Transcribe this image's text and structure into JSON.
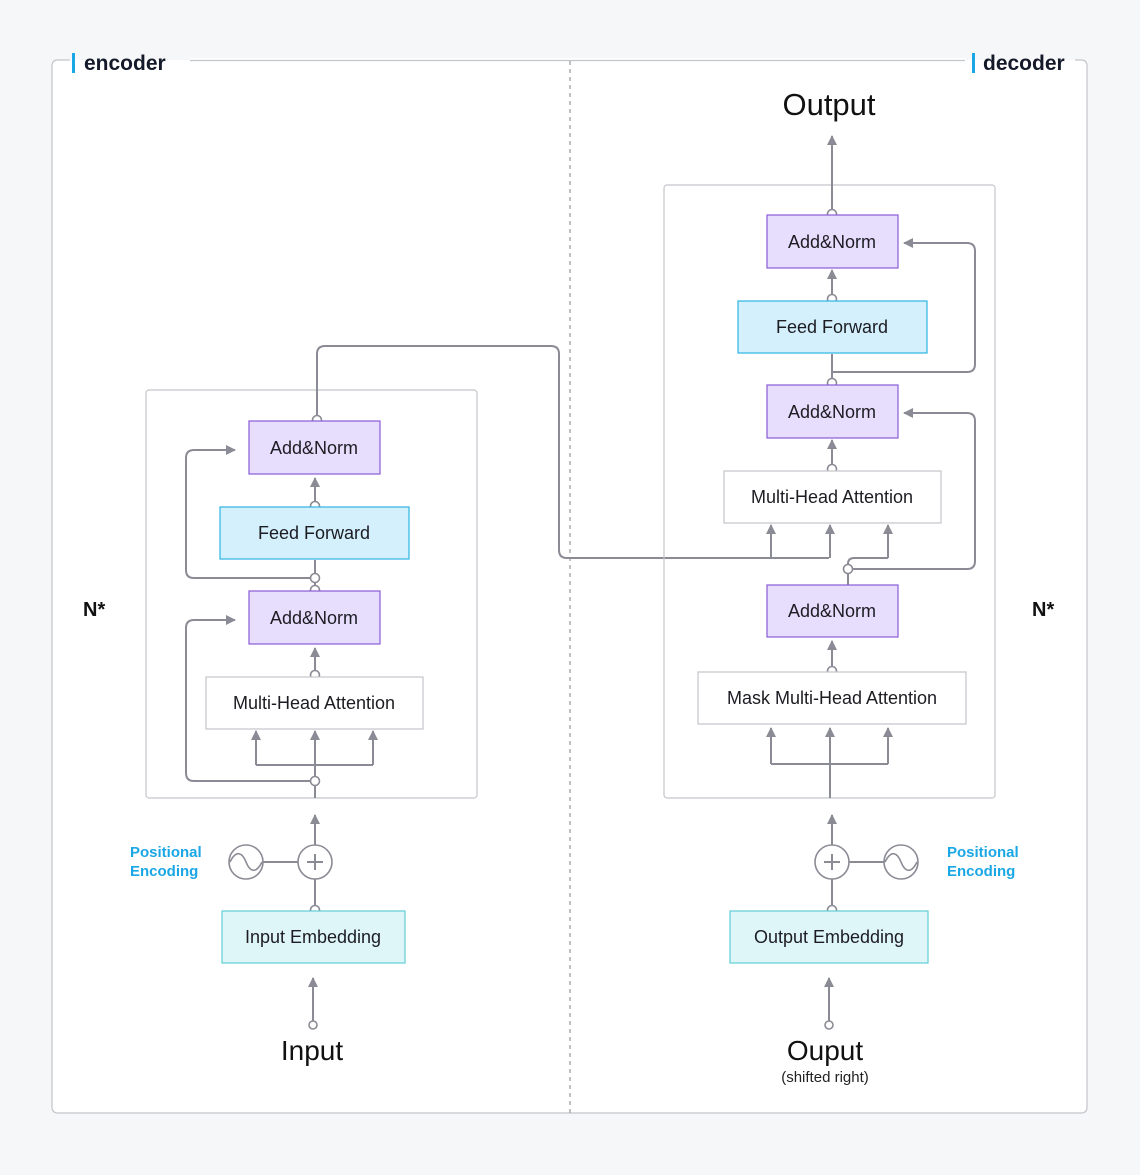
{
  "encoder": {
    "title": "encoder",
    "repeat_label": "N*",
    "positional_encoding": [
      "Positional",
      "Encoding"
    ],
    "blocks": {
      "add_norm_top": "Add&Norm",
      "feed_forward": "Feed Forward",
      "add_norm_bottom": "Add&Norm",
      "attention": "Multi-Head Attention"
    },
    "embedding": "Input Embedding",
    "input": "Input"
  },
  "decoder": {
    "title": "decoder",
    "repeat_label": "N*",
    "positional_encoding": [
      "Positional",
      "Encoding"
    ],
    "output": "Output",
    "blocks": {
      "add_norm_top": "Add&Norm",
      "feed_forward": "Feed Forward",
      "add_norm_middle": "Add&Norm",
      "attention": "Multi-Head Attention",
      "add_norm_bottom": "Add&Norm",
      "masked_attention": "Mask Multi-Head Attention"
    },
    "embedding": "Output Embedding",
    "input": "Ouput",
    "input_note": "(shifted right)"
  },
  "colors": {
    "add_norm": "#e7ddfd",
    "feed_forward": "#d3f0fc",
    "embedding": "#dff6f8",
    "accent": "#1aa7e5",
    "line": "#8b8b95"
  }
}
